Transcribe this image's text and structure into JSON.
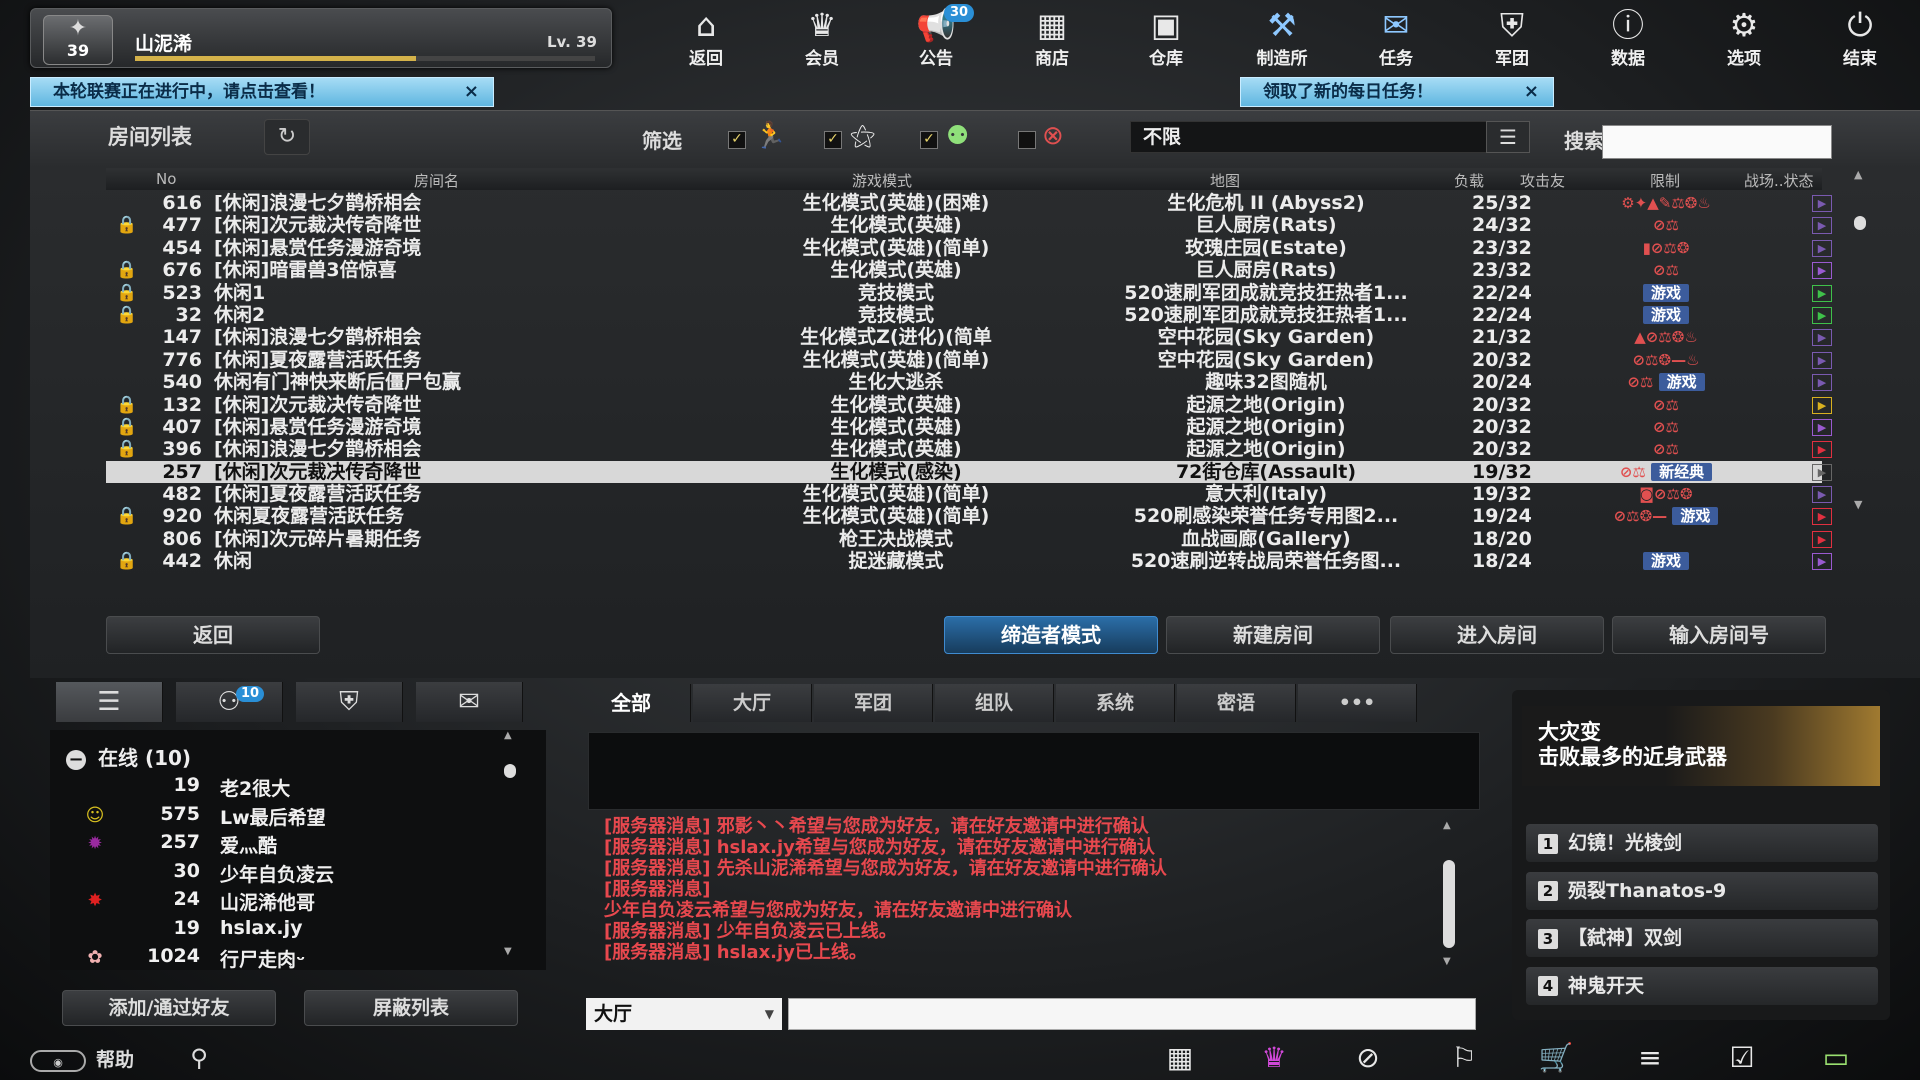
{
  "player": {
    "rank": "39",
    "name": "山泥浠",
    "level": "Lv. 39",
    "exp_fraction": 0.61
  },
  "nav": [
    {
      "label": "返回",
      "icon": "home-icon",
      "glyph": "⌂"
    },
    {
      "label": "会员",
      "icon": "crown-icon",
      "glyph": "♛"
    },
    {
      "label": "公告",
      "icon": "megaphone-icon",
      "glyph": "📢",
      "badge": "30"
    },
    {
      "label": "商店",
      "icon": "shop-icon",
      "glyph": "▦"
    },
    {
      "label": "仓库",
      "icon": "warehouse-icon",
      "glyph": "▣"
    },
    {
      "label": "制造所",
      "icon": "factory-icon",
      "glyph": "⚒"
    },
    {
      "label": "任务",
      "icon": "mission-icon",
      "glyph": "✉"
    },
    {
      "label": "军团",
      "icon": "clan-icon",
      "glyph": "⛨"
    },
    {
      "label": "数据",
      "icon": "info-icon",
      "glyph": "ⓘ"
    },
    {
      "label": "选项",
      "icon": "gear-icon",
      "glyph": "⚙"
    },
    {
      "label": "结束",
      "icon": "power-icon",
      "glyph": "⏻"
    }
  ],
  "notices": {
    "league": "本轮联赛正在进行中，请点击查看！",
    "daily": "领取了新的每日任务！",
    "close": "×"
  },
  "room_list": {
    "title": "房间列表",
    "refresh": "↻",
    "filter_label": "筛选",
    "map_filter": "不限",
    "search_label": "搜索",
    "search_value": "",
    "columns": [
      "No",
      "房间名",
      "游戏模式",
      "地图",
      "负载",
      "攻击友",
      "限制",
      "战场..状态"
    ],
    "rows": [
      {
        "locked": false,
        "no": "616",
        "name": "[休闲]浪漫七夕鹊桥相会",
        "mode": "生化模式(英雄)(困难)",
        "map": "生化危机 II (Abyss2)",
        "load": "25/32",
        "limit": "⚙✦▲✎⚖❂♨",
        "status_color": "#7a5ab0"
      },
      {
        "locked": true,
        "no": "477",
        "name": "[休闲]次元裁决传奇降世",
        "mode": "生化模式(英雄)",
        "map": "巨人厨房(Rats)",
        "load": "24/32",
        "limit": "⊘⚖",
        "status_color": "#7a5ab0"
      },
      {
        "locked": false,
        "no": "454",
        "name": "[休闲]悬赏任务漫游奇境",
        "mode": "生化模式(英雄)(简单)",
        "map": "玫瑰庄园(Estate)",
        "load": "23/32",
        "limit": "▮⊘⚖❂",
        "status_color": "#7a5ab0"
      },
      {
        "locked": true,
        "no": "676",
        "name": "[休闲]暗雷兽3倍惊喜",
        "mode": "生化模式(英雄)",
        "map": "巨人厨房(Rats)",
        "load": "23/32",
        "limit": "⊘⚖",
        "status_color": "#9a5ad0"
      },
      {
        "locked": true,
        "no": "523",
        "name": "休闲1",
        "mode": "竞技模式",
        "map": "520速刷军团成就竞技狂热者1...",
        "load": "22/24",
        "limit_tag": "游戏",
        "status_color": "#3fc04a"
      },
      {
        "locked": true,
        "no": "32",
        "name": "休闲2",
        "mode": "竞技模式",
        "map": "520速刷军团成就竞技狂热者1...",
        "load": "22/24",
        "limit_tag": "游戏",
        "status_color": "#3fc04a"
      },
      {
        "locked": false,
        "no": "147",
        "name": "[休闲]浪漫七夕鹊桥相会",
        "mode": "生化模式Z(进化)(简单",
        "map": "空中花园(Sky Garden)",
        "load": "21/32",
        "limit": "▲⊘⚖❂♨",
        "status_color": "#7a5ab0"
      },
      {
        "locked": false,
        "no": "776",
        "name": "[休闲]夏夜露营活跃任务",
        "mode": "生化模式(英雄)(简单)",
        "map": "空中花园(Sky Garden)",
        "load": "20/32",
        "limit": "⊘⚖❂—♨",
        "status_color": "#7a5ab0"
      },
      {
        "locked": false,
        "no": "540",
        "name": "休闲有门神快来断后僵尸包赢",
        "mode": "生化大逃杀",
        "map": "趣味32图随机",
        "load": "20/24",
        "limit": "⊘⚖",
        "limit_tag": "游戏",
        "status_color": "#7a5ab0"
      },
      {
        "locked": true,
        "no": "132",
        "name": "[休闲]次元裁决传奇降世",
        "mode": "生化模式(英雄)",
        "map": "起源之地(Origin)",
        "load": "20/32",
        "limit": "⊘⚖",
        "status_color": "#d8b020"
      },
      {
        "locked": true,
        "no": "407",
        "name": "[休闲]悬赏任务漫游奇境",
        "mode": "生化模式(英雄)",
        "map": "起源之地(Origin)",
        "load": "20/32",
        "limit": "⊘⚖",
        "status_color": "#9a5ad0"
      },
      {
        "locked": true,
        "no": "396",
        "name": "[休闲]浪漫七夕鹊桥相会",
        "mode": "生化模式(英雄)",
        "map": "起源之地(Origin)",
        "load": "20/32",
        "limit": "⊘⚖",
        "status_color": "#e03040"
      },
      {
        "locked": false,
        "no": "257",
        "name": "[休闲]次元裁决传奇降世",
        "mode": "生化模式(感染)",
        "map": "72街仓库(Assault)",
        "load": "19/32",
        "limit": "⊘⚖",
        "limit_tag": "新经典",
        "status_color": "#666",
        "selected": true
      },
      {
        "locked": false,
        "no": "482",
        "name": "[休闲]夏夜露营活跃任务",
        "mode": "生化模式(英雄)(简单)",
        "map": "意大利(Italy)",
        "load": "19/32",
        "limit": "◙⊘⚖❂",
        "status_color": "#7a5ab0"
      },
      {
        "locked": true,
        "no": "920",
        "name": "休闲夏夜露营活跃任务",
        "mode": "生化模式(英雄)(简单)",
        "map": "520刷感染荣誉任务专用图2...",
        "load": "19/24",
        "limit": "⊘⚖❂—",
        "limit_tag": "游戏",
        "status_color": "#e03040"
      },
      {
        "locked": false,
        "no": "806",
        "name": "[休闲]次元碎片暑期任务",
        "mode": "枪王决战模式",
        "map": "血战画廊(Gallery)",
        "load": "18/20",
        "limit": "",
        "status_color": "#e03040"
      },
      {
        "locked": true,
        "no": "442",
        "name": "休闲",
        "mode": "捉迷藏模式",
        "map": "520速刷逆转战局荣誉任务图...",
        "load": "18/24",
        "limit_tag": "游戏",
        "status_color": "#9a5ad0"
      }
    ],
    "buttons": {
      "back": "返回",
      "filter_mode": "缔造者模式",
      "create": "新建房间",
      "enter": "进入房间",
      "enter_no": "输入房间号"
    }
  },
  "friends": {
    "online_header": "在线 (10)",
    "tab_badge": "10",
    "list": [
      {
        "level": "19",
        "name": "老2很大",
        "avatar": ""
      },
      {
        "level": "575",
        "name": "Lw最后希望",
        "avatar": "☺",
        "avatar_color": "#d8c020"
      },
      {
        "level": "257",
        "name": "爱灬酷",
        "avatar": "✹",
        "avatar_color": "#9a2aa0"
      },
      {
        "level": "30",
        "name": "少年自负凌云",
        "avatar": ""
      },
      {
        "level": "24",
        "name": "山泥浠他哥",
        "avatar": "✸",
        "avatar_color": "#e02020"
      },
      {
        "level": "19",
        "name": "hslax.jy",
        "avatar": ""
      },
      {
        "level": "1024",
        "name": "行尸走肉ᵕ",
        "avatar": "✿",
        "avatar_color": "#f0b0b0"
      }
    ],
    "add_button": "添加/通过好友",
    "block_button": "屏蔽列表"
  },
  "chat": {
    "tabs": [
      "全部",
      "大厅",
      "军团",
      "组队",
      "系统",
      "密语",
      "•••"
    ],
    "messages": [
      "[服务器消息] 邪影丶丶希望与您成为好友，请在好友邀请中进行确认",
      "[服务器消息] hslax.jy希望与您成为好友，请在好友邀请中进行确认",
      "[服务器消息] 先杀山泥浠希望与您成为好友，请在好友邀请中进行确认",
      "[服务器消息]",
      "少年自负凌云希望与您成为好友，请在好友邀请中进行确认",
      "[服务器消息] 少年自负凌云已上线。",
      "[服务器消息] hslax.jy已上线。"
    ],
    "channel": "大厅",
    "input_value": ""
  },
  "ranking": {
    "title_line1": "大灾变",
    "title_line2": "击败最多的近身武器",
    "items": [
      {
        "n": "1",
        "name": "幻镜！光棱剑"
      },
      {
        "n": "2",
        "name": "殒裂Thanatos-9"
      },
      {
        "n": "3",
        "name": "【弑神】双剑"
      },
      {
        "n": "4",
        "name": "神鬼开天"
      }
    ]
  },
  "bottom": {
    "help": "帮助",
    "icons": [
      "calendar-icon",
      "crown-icon",
      "compass-icon",
      "runner-icon",
      "cart-icon",
      "list-icon",
      "checklist-icon",
      "battery-icon"
    ],
    "glyphs": [
      "▦",
      "♛",
      "⊘",
      "⚐",
      "🛒",
      "≡",
      "☑",
      "▭"
    ]
  }
}
